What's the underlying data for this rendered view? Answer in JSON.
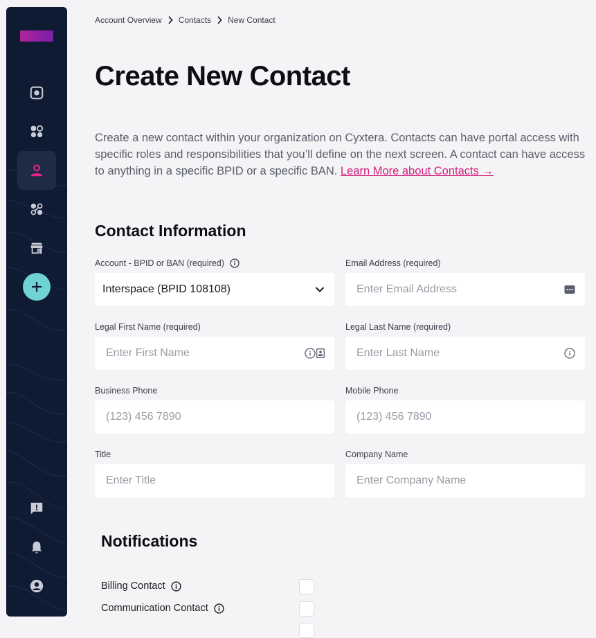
{
  "sidebar": {
    "items": [
      {
        "icon": "dashboard-icon"
      },
      {
        "icon": "services-icon"
      },
      {
        "icon": "contacts-icon",
        "active": true
      },
      {
        "icon": "interconnect-icon"
      },
      {
        "icon": "marketplace-icon"
      }
    ],
    "bottom": [
      {
        "icon": "feedback-icon"
      },
      {
        "icon": "bell-icon"
      },
      {
        "icon": "account-icon"
      }
    ],
    "accent": "#6fd3d3"
  },
  "breadcrumb": {
    "items": [
      "Account Overview",
      "Contacts",
      "New Contact"
    ]
  },
  "page": {
    "title": "Create New Contact",
    "intro": "Create a new contact within your organization on Cyxtera. Contacts can have portal access with specific roles and responsibilities that you’ll define on the next screen. A contact can have access to anything in a specific BPID or a specific BAN.",
    "learn_more": "Learn More about Contacts →",
    "link_color": "#d4207f"
  },
  "contact_info": {
    "title": "Contact Information",
    "account": {
      "label": "Account - BPID or BAN (required)",
      "value": "Interspace (BPID 108108)"
    },
    "email": {
      "label": "Email Address (required)",
      "placeholder": "Enter Email Address"
    },
    "first_name": {
      "label": "Legal First Name (required)",
      "placeholder": "Enter First Name"
    },
    "last_name": {
      "label": "Legal Last Name (required)",
      "placeholder": "Enter Last Name"
    },
    "business_phone": {
      "label": "Business Phone",
      "placeholder": "(123) 456 7890"
    },
    "mobile_phone": {
      "label": "Mobile Phone",
      "placeholder": "(123) 456 7890"
    },
    "title_field": {
      "label": "Title",
      "placeholder": "Enter Title"
    },
    "company": {
      "label": "Company Name",
      "placeholder": "Enter Company Name"
    }
  },
  "notifications": {
    "title": "Notifications",
    "items": [
      {
        "label": "Billing Contact",
        "checked": false
      },
      {
        "label": "Communication Contact",
        "checked": false
      }
    ]
  }
}
